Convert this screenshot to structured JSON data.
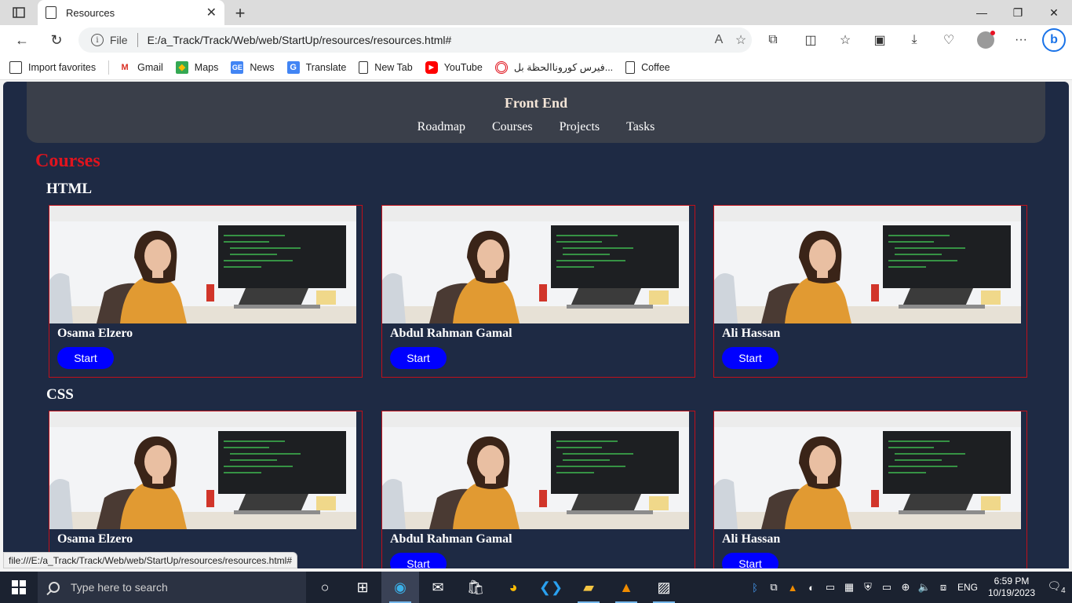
{
  "browser": {
    "tab_title": "Resources",
    "omnibox_scheme": "File",
    "url": "E:/a_Track/Track/Web/web/StartUp/resources/resources.html#",
    "status_url": "file:///E:/a_Track/Track/Web/web/StartUp/resources/resources.html#"
  },
  "favorites": [
    {
      "label": "Import favorites",
      "icon": "import-icon"
    },
    {
      "label": "Gmail",
      "icon": "gmail-icon"
    },
    {
      "label": "Maps",
      "icon": "maps-icon"
    },
    {
      "label": "News",
      "icon": "news-icon"
    },
    {
      "label": "Translate",
      "icon": "translate-icon"
    },
    {
      "label": "New Tab",
      "icon": "page-icon"
    },
    {
      "label": "YouTube",
      "icon": "youtube-icon"
    },
    {
      "label": "فيرس كوروناالحظة بل...",
      "icon": "target-icon"
    },
    {
      "label": "Coffee",
      "icon": "page-icon"
    }
  ],
  "site": {
    "title": "Front End",
    "nav": [
      "Roadmap",
      "Courses",
      "Projects",
      "Tasks"
    ],
    "page_heading": "Courses",
    "sections": [
      {
        "title": "HTML",
        "cards": [
          {
            "name": "Osama Elzero",
            "button": "Start"
          },
          {
            "name": "Abdul Rahman Gamal",
            "button": "Start"
          },
          {
            "name": "Ali Hassan",
            "button": "Start"
          }
        ]
      },
      {
        "title": "CSS",
        "cards": [
          {
            "name": "Osama Elzero",
            "button": "Start"
          },
          {
            "name": "Abdul Rahman Gamal",
            "button": "Start"
          },
          {
            "name": "Ali Hassan",
            "button": "Start"
          }
        ]
      }
    ]
  },
  "taskbar": {
    "search_placeholder": "Type here to search",
    "language": "ENG",
    "time": "6:59 PM",
    "date": "10/19/2023",
    "notification_count": "4"
  },
  "colors": {
    "page_bg": "#1e2a44",
    "header_bg": "#3a3f4a",
    "accent_red": "#e0141e",
    "button_blue": "#0000ff"
  }
}
